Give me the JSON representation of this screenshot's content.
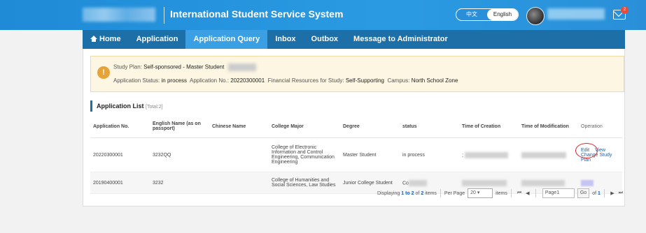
{
  "header": {
    "title": "International Student Service System",
    "lang": [
      "中文",
      "English"
    ],
    "notification_count": "2",
    "accent": "#2a9be3"
  },
  "nav": [
    "Home",
    "Application",
    "Application Query",
    "Inbox",
    "Outbox",
    "Message to Administrator"
  ],
  "notice": {
    "study_plan_label": "Study Plan:",
    "study_plan_value": "Self-sponsored - Master Student",
    "status_label": "Application Status:",
    "status_value": "in process",
    "app_no_label": "Application No.:",
    "app_no_value": "20220300001",
    "financial_label": "Financial Resources for Study:",
    "financial_value": "Self-Supporting",
    "campus_label": "Campus:",
    "campus_value": "North School Zone"
  },
  "list": {
    "title": "Application List",
    "total": "[Total:2]",
    "columns": [
      "Application No.",
      "English Name (as on passport)",
      "Chinese Name",
      "College Major",
      "Degree",
      "status",
      "Time of Creation",
      "Time of Modification",
      "Operation"
    ],
    "rows": [
      {
        "no": "20220300001",
        "english_name": "3232QQ",
        "chinese_name": "",
        "major": "College of Electronic Information and Control Engineering, Communication Engineering",
        "degree": "Master Student",
        "status": "in process",
        "created_prefix": ";",
        "op_edit": "Edit",
        "op_view": "View",
        "op_change": "Change Study Plan"
      },
      {
        "no": "20190400001",
        "english_name": "3232",
        "chinese_name": "",
        "major": "College of Humanities and Social Sciences, Law Studies",
        "degree": "Junior College Student",
        "status": "Co",
        "created_prefix": ""
      }
    ]
  },
  "pager": {
    "displaying": "Displaying",
    "range_start": "1",
    "to": "to",
    "range_end": "2",
    "of": "of",
    "total": "2",
    "items": "items",
    "per_page_label": "Per Page",
    "per_page_value": "20",
    "items_label": "items",
    "page_value": "Page1",
    "go": "Go",
    "of_label": "of",
    "page_total": "1"
  }
}
